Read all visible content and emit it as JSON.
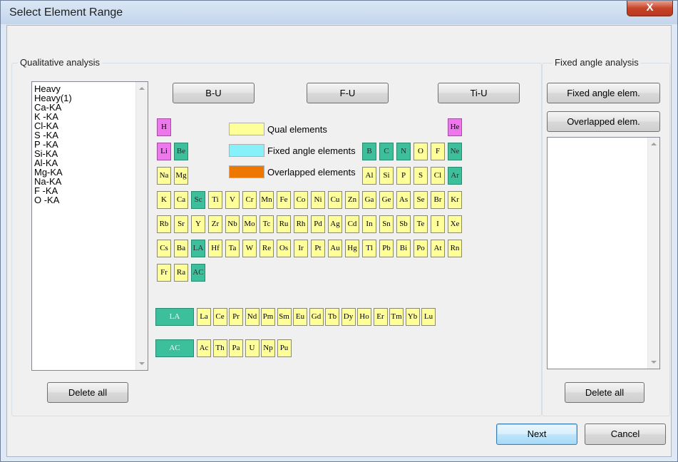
{
  "window": {
    "title": "Select Element Range",
    "close_glyph": "X"
  },
  "qualitative": {
    "group_label": "Qualitative analysis",
    "list_items": [
      "Heavy",
      "Heavy(1)",
      "Ca-KA",
      "K -KA",
      "Cl-KA",
      "S -KA",
      "P -KA",
      "Si-KA",
      "Al-KA",
      "Mg-KA",
      "Na-KA",
      "F -KA",
      "O -KA"
    ],
    "delete_all": "Delete all"
  },
  "presets": {
    "b_u": "B-U",
    "f_u": "F-U",
    "ti_u": "Ti-U"
  },
  "legend": {
    "qual": "Qual elements",
    "fixed": "Fixed angle elements",
    "overlapped": "Overlapped elements",
    "colors": {
      "qual": "#ffff99",
      "fixed": "#88f0f8",
      "overlapped": "#ee7700"
    }
  },
  "table": {
    "colors": {
      "qual": "#ffff99",
      "selected": "#3cc09c",
      "light": "#ee77ee"
    },
    "elements": [
      {
        "s": "H",
        "r": 0,
        "c": 0,
        "t": "p"
      },
      {
        "s": "He",
        "r": 0,
        "c": 17,
        "t": "p"
      },
      {
        "s": "Li",
        "r": 1,
        "c": 0,
        "t": "p"
      },
      {
        "s": "Be",
        "r": 1,
        "c": 1,
        "t": "g"
      },
      {
        "s": "B",
        "r": 1,
        "c": 12,
        "t": "g"
      },
      {
        "s": "C",
        "r": 1,
        "c": 13,
        "t": "g"
      },
      {
        "s": "N",
        "r": 1,
        "c": 14,
        "t": "g"
      },
      {
        "s": "O",
        "r": 1,
        "c": 15,
        "t": "q"
      },
      {
        "s": "F",
        "r": 1,
        "c": 16,
        "t": "q"
      },
      {
        "s": "Ne",
        "r": 1,
        "c": 17,
        "t": "g"
      },
      {
        "s": "Na",
        "r": 2,
        "c": 0,
        "t": "q"
      },
      {
        "s": "Mg",
        "r": 2,
        "c": 1,
        "t": "q"
      },
      {
        "s": "Al",
        "r": 2,
        "c": 12,
        "t": "q"
      },
      {
        "s": "Si",
        "r": 2,
        "c": 13,
        "t": "q"
      },
      {
        "s": "P",
        "r": 2,
        "c": 14,
        "t": "q"
      },
      {
        "s": "S",
        "r": 2,
        "c": 15,
        "t": "q"
      },
      {
        "s": "Cl",
        "r": 2,
        "c": 16,
        "t": "q"
      },
      {
        "s": "Ar",
        "r": 2,
        "c": 17,
        "t": "g"
      },
      {
        "s": "K",
        "r": 3,
        "c": 0,
        "t": "q"
      },
      {
        "s": "Ca",
        "r": 3,
        "c": 1,
        "t": "q"
      },
      {
        "s": "Sc",
        "r": 3,
        "c": 2,
        "t": "g"
      },
      {
        "s": "Ti",
        "r": 3,
        "c": 3,
        "t": "q"
      },
      {
        "s": "V",
        "r": 3,
        "c": 4,
        "t": "q"
      },
      {
        "s": "Cr",
        "r": 3,
        "c": 5,
        "t": "q"
      },
      {
        "s": "Mn",
        "r": 3,
        "c": 6,
        "t": "q"
      },
      {
        "s": "Fe",
        "r": 3,
        "c": 7,
        "t": "q"
      },
      {
        "s": "Co",
        "r": 3,
        "c": 8,
        "t": "q"
      },
      {
        "s": "Ni",
        "r": 3,
        "c": 9,
        "t": "q"
      },
      {
        "s": "Cu",
        "r": 3,
        "c": 10,
        "t": "q"
      },
      {
        "s": "Zn",
        "r": 3,
        "c": 11,
        "t": "q"
      },
      {
        "s": "Ga",
        "r": 3,
        "c": 12,
        "t": "q"
      },
      {
        "s": "Ge",
        "r": 3,
        "c": 13,
        "t": "q"
      },
      {
        "s": "As",
        "r": 3,
        "c": 14,
        "t": "q"
      },
      {
        "s": "Se",
        "r": 3,
        "c": 15,
        "t": "q"
      },
      {
        "s": "Br",
        "r": 3,
        "c": 16,
        "t": "q"
      },
      {
        "s": "Kr",
        "r": 3,
        "c": 17,
        "t": "q"
      },
      {
        "s": "Rb",
        "r": 4,
        "c": 0,
        "t": "q"
      },
      {
        "s": "Sr",
        "r": 4,
        "c": 1,
        "t": "q"
      },
      {
        "s": "Y",
        "r": 4,
        "c": 2,
        "t": "q"
      },
      {
        "s": "Zr",
        "r": 4,
        "c": 3,
        "t": "q"
      },
      {
        "s": "Nb",
        "r": 4,
        "c": 4,
        "t": "q"
      },
      {
        "s": "Mo",
        "r": 4,
        "c": 5,
        "t": "q"
      },
      {
        "s": "Tc",
        "r": 4,
        "c": 6,
        "t": "q"
      },
      {
        "s": "Ru",
        "r": 4,
        "c": 7,
        "t": "q"
      },
      {
        "s": "Rh",
        "r": 4,
        "c": 8,
        "t": "q"
      },
      {
        "s": "Pd",
        "r": 4,
        "c": 9,
        "t": "q"
      },
      {
        "s": "Ag",
        "r": 4,
        "c": 10,
        "t": "q"
      },
      {
        "s": "Cd",
        "r": 4,
        "c": 11,
        "t": "q"
      },
      {
        "s": "In",
        "r": 4,
        "c": 12,
        "t": "q"
      },
      {
        "s": "Sn",
        "r": 4,
        "c": 13,
        "t": "q"
      },
      {
        "s": "Sb",
        "r": 4,
        "c": 14,
        "t": "q"
      },
      {
        "s": "Te",
        "r": 4,
        "c": 15,
        "t": "q"
      },
      {
        "s": "I",
        "r": 4,
        "c": 16,
        "t": "q"
      },
      {
        "s": "Xe",
        "r": 4,
        "c": 17,
        "t": "q"
      },
      {
        "s": "Cs",
        "r": 5,
        "c": 0,
        "t": "q"
      },
      {
        "s": "Ba",
        "r": 5,
        "c": 1,
        "t": "q"
      },
      {
        "s": "LA",
        "r": 5,
        "c": 2,
        "t": "g"
      },
      {
        "s": "Hf",
        "r": 5,
        "c": 3,
        "t": "q"
      },
      {
        "s": "Ta",
        "r": 5,
        "c": 4,
        "t": "q"
      },
      {
        "s": "W",
        "r": 5,
        "c": 5,
        "t": "q"
      },
      {
        "s": "Re",
        "r": 5,
        "c": 6,
        "t": "q"
      },
      {
        "s": "Os",
        "r": 5,
        "c": 7,
        "t": "q"
      },
      {
        "s": "Ir",
        "r": 5,
        "c": 8,
        "t": "q"
      },
      {
        "s": "Pt",
        "r": 5,
        "c": 9,
        "t": "q"
      },
      {
        "s": "Au",
        "r": 5,
        "c": 10,
        "t": "q"
      },
      {
        "s": "Hg",
        "r": 5,
        "c": 11,
        "t": "q"
      },
      {
        "s": "Tl",
        "r": 5,
        "c": 12,
        "t": "q"
      },
      {
        "s": "Pb",
        "r": 5,
        "c": 13,
        "t": "q"
      },
      {
        "s": "Bi",
        "r": 5,
        "c": 14,
        "t": "q"
      },
      {
        "s": "Po",
        "r": 5,
        "c": 15,
        "t": "q"
      },
      {
        "s": "At",
        "r": 5,
        "c": 16,
        "t": "q"
      },
      {
        "s": "Rn",
        "r": 5,
        "c": 17,
        "t": "q"
      },
      {
        "s": "Fr",
        "r": 6,
        "c": 0,
        "t": "q"
      },
      {
        "s": "Ra",
        "r": 6,
        "c": 1,
        "t": "q"
      },
      {
        "s": "AC",
        "r": 6,
        "c": 2,
        "t": "g"
      }
    ],
    "lanthanide_label": "LA",
    "lanthanides": [
      "La",
      "Ce",
      "Pr",
      "Nd",
      "Pm",
      "Sm",
      "Eu",
      "Gd",
      "Tb",
      "Dy",
      "Ho",
      "Er",
      "Tm",
      "Yb",
      "Lu"
    ],
    "actinide_label": "AC",
    "actinides": [
      "Ac",
      "Th",
      "Pa",
      "U",
      "Np",
      "Pu"
    ]
  },
  "fixed_angle": {
    "group_label": "Fixed angle analysis",
    "fixed_elem": "Fixed angle elem.",
    "overlapped_elem": "Overlapped elem.",
    "delete_all": "Delete all"
  },
  "footer": {
    "next": "Next",
    "cancel": "Cancel"
  }
}
